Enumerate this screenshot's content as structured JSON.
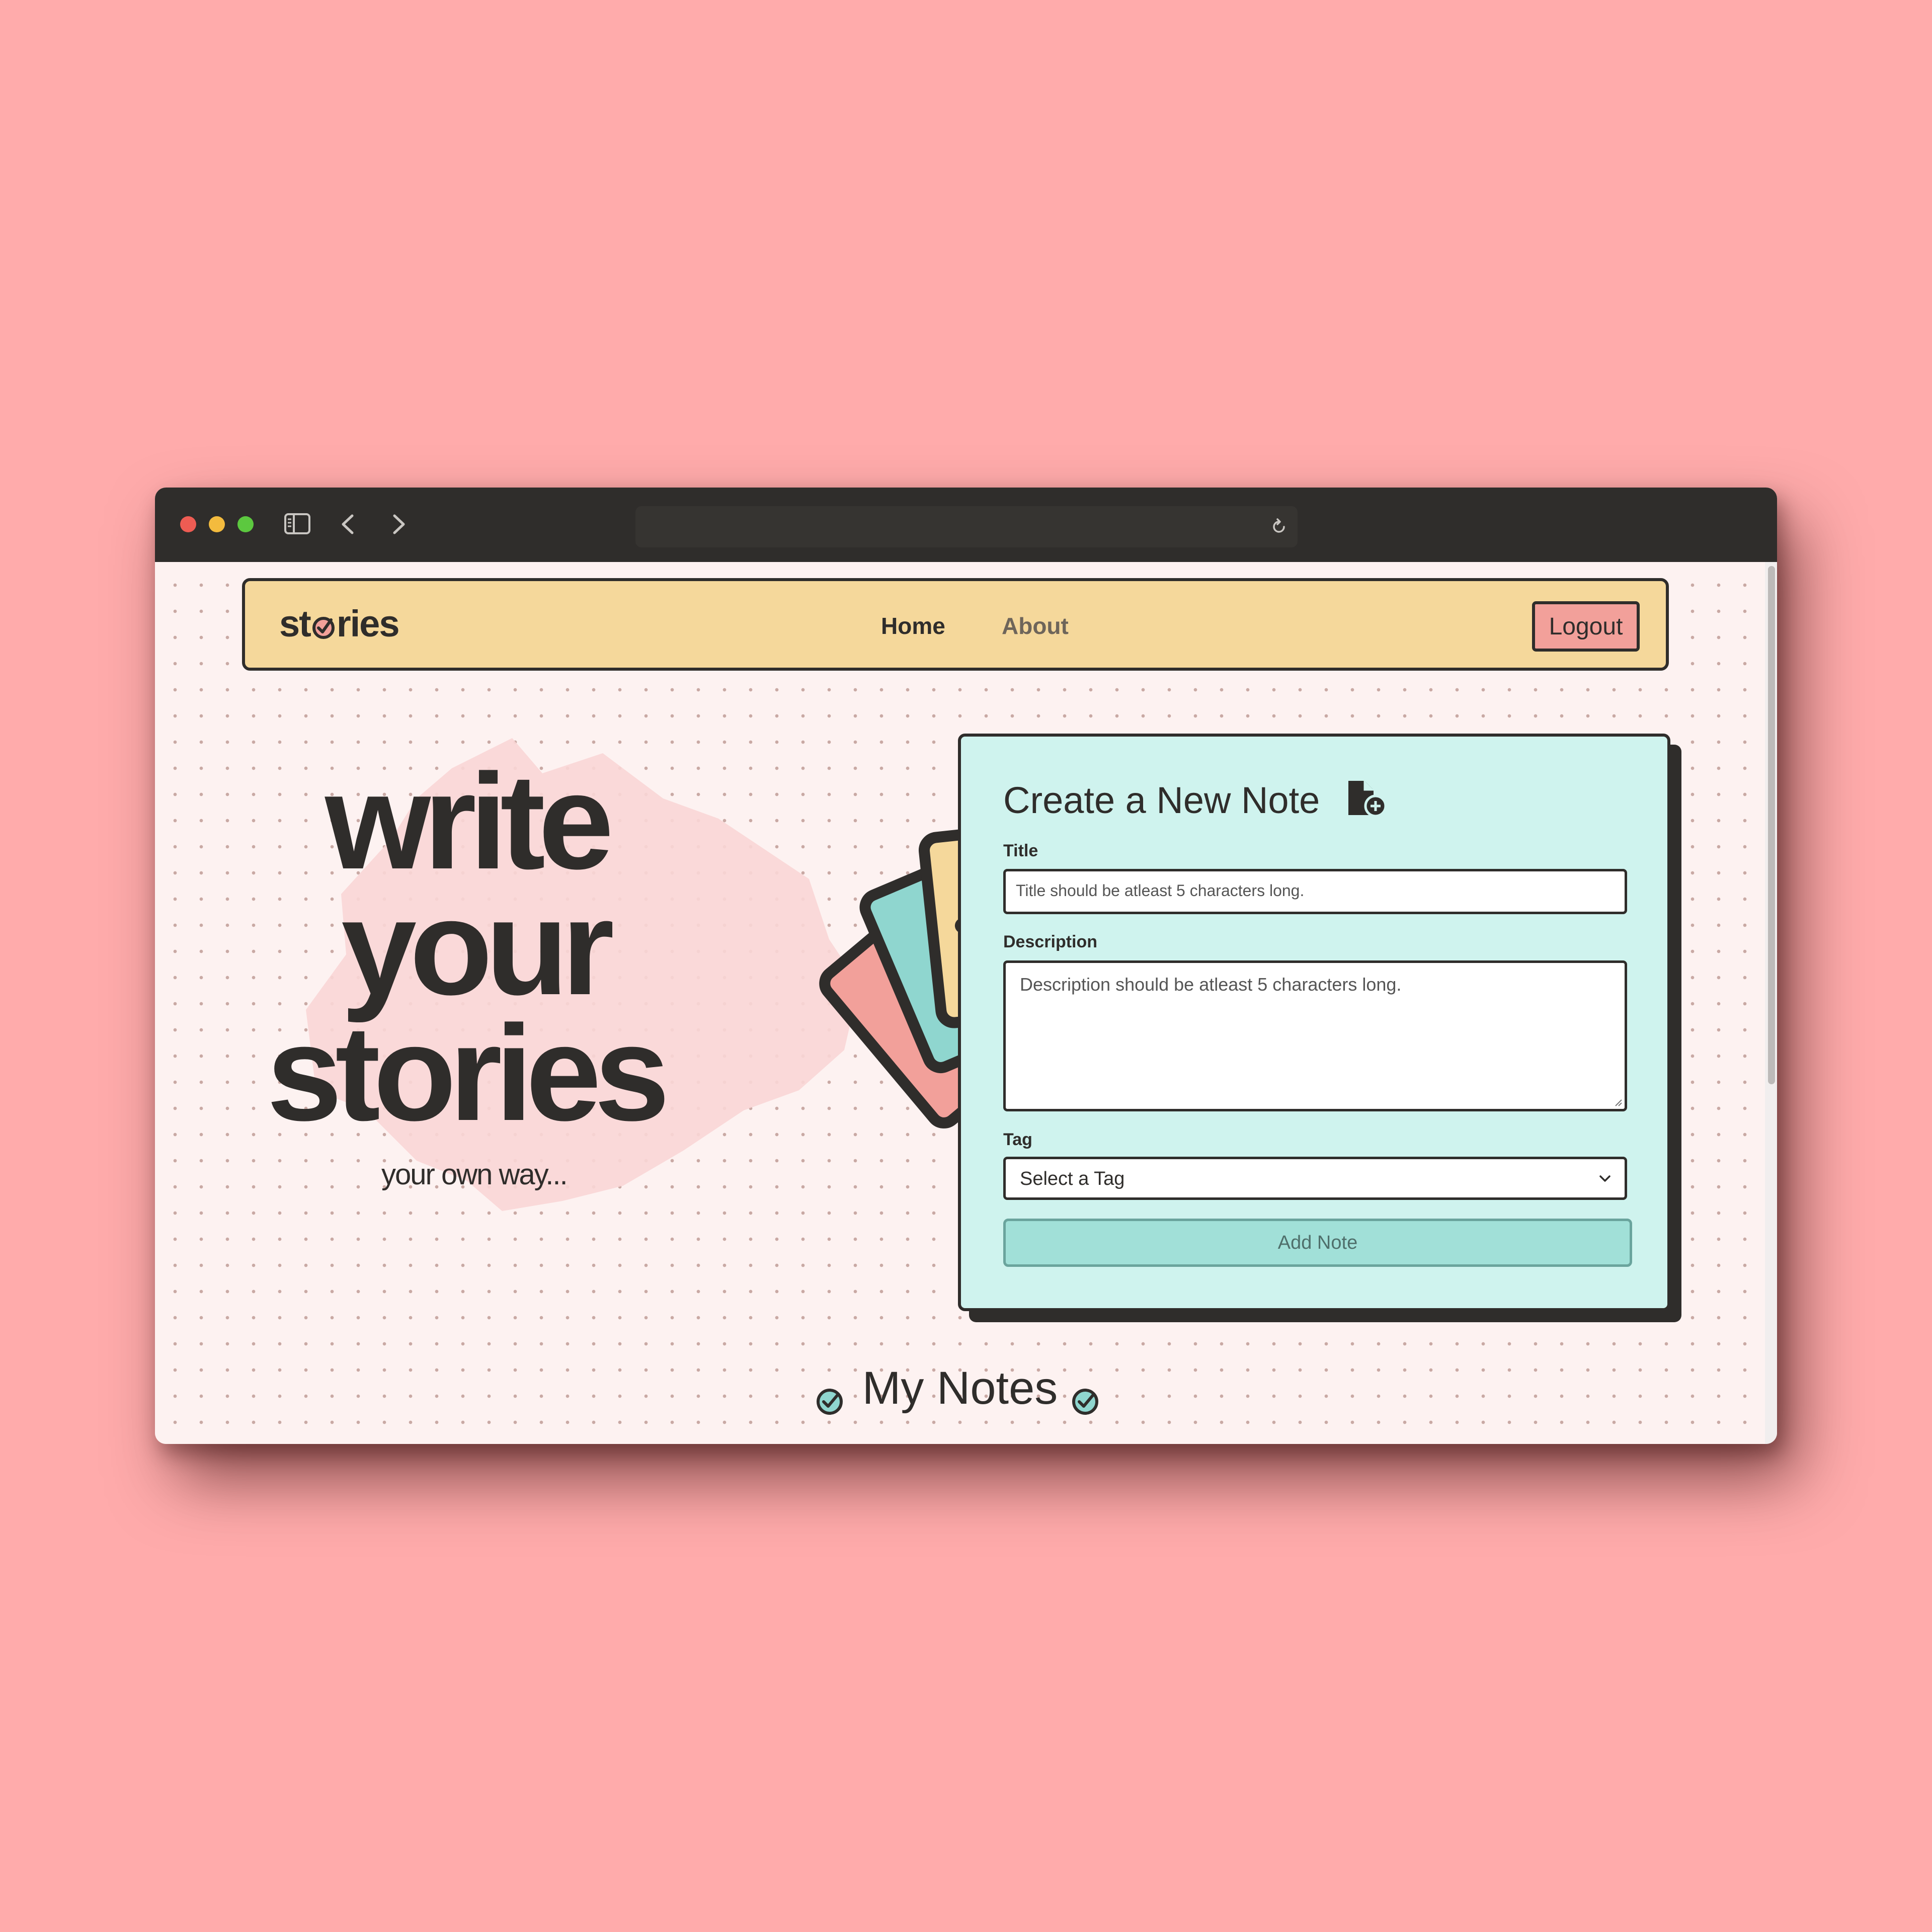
{
  "browser": {
    "icons": [
      "sidebar-icon",
      "back-icon",
      "forward-icon",
      "reload-icon",
      "share-icon",
      "new-tab-icon",
      "tab-overview-icon"
    ]
  },
  "navbar": {
    "logo_prefix": "st",
    "logo_suffix": "ries",
    "home_label": "Home",
    "about_label": "About",
    "logout_label": "Logout"
  },
  "hero": {
    "line1": "write",
    "line2": "your",
    "line3": "stories",
    "tagline": "your own way..."
  },
  "form": {
    "heading": "Create a New Note",
    "title_label": "Title",
    "title_placeholder": "Title should be atleast 5 characters long.",
    "description_label": "Description",
    "description_placeholder": "Description should be atleast 5 characters long.",
    "tag_label": "Tag",
    "tag_selected": "Select a Tag",
    "submit_label": "Add Note"
  },
  "notes_section": {
    "heading": "My Notes"
  },
  "colors": {
    "backdrop": "#ffabab",
    "dark": "#2f2d2b",
    "yellow": "#f5d89b",
    "pink": "#f2a09a",
    "teal": "#8fd6cf",
    "card_bg": "#cff3ee"
  }
}
